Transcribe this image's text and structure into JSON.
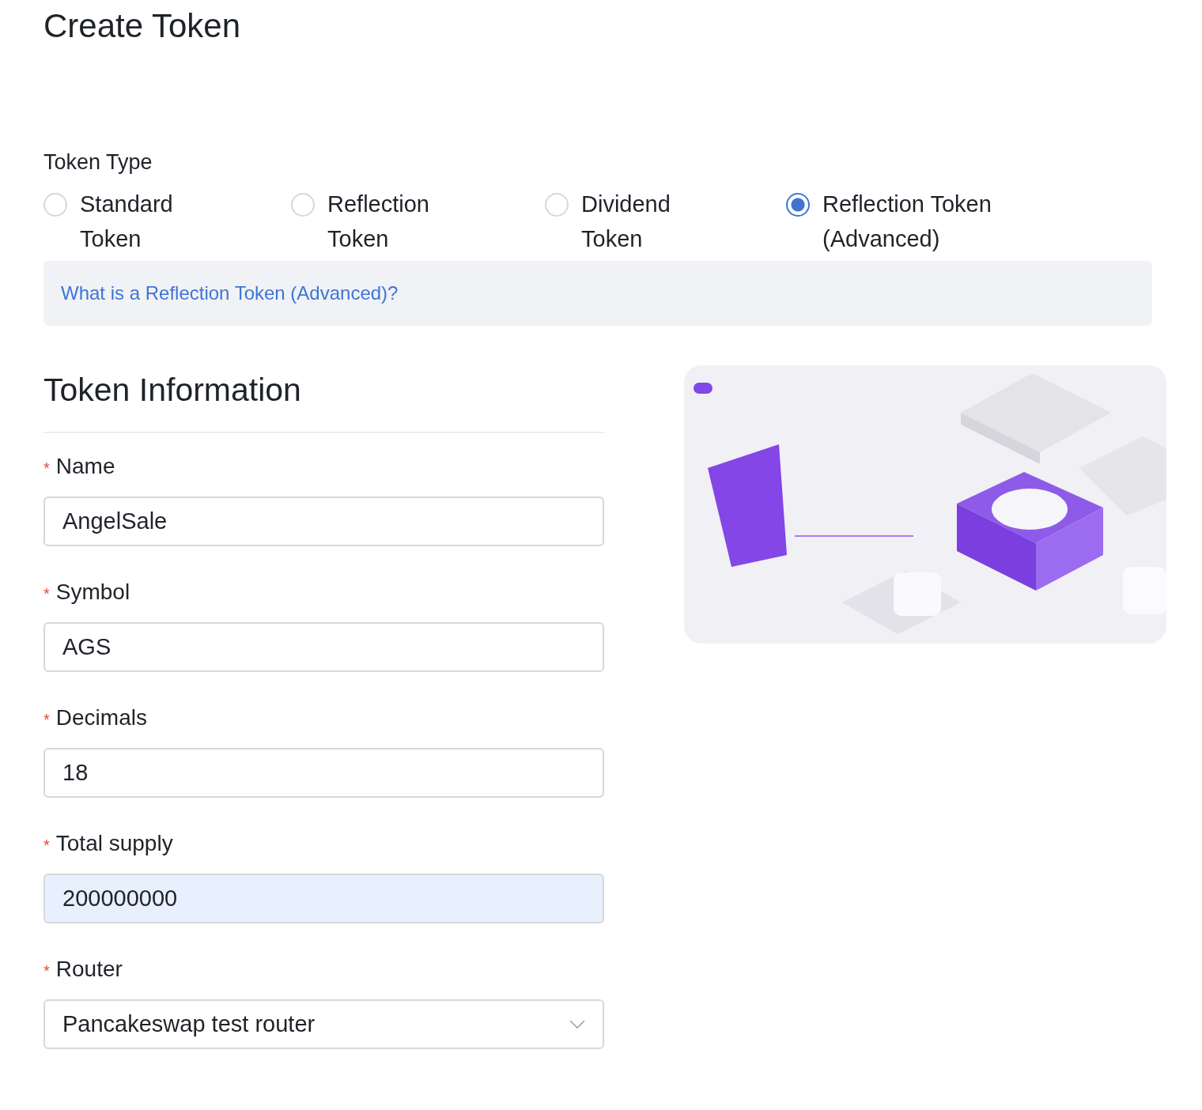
{
  "title": "Create Token",
  "token_type": {
    "label": "Token Type",
    "options": [
      {
        "label": "Standard Token",
        "selected": false
      },
      {
        "label": "Reflection Token",
        "selected": false
      },
      {
        "label": "Dividend Token",
        "selected": false
      },
      {
        "label": "Reflection Token (Advanced)",
        "selected": true
      }
    ]
  },
  "info_link": "What is a Reflection Token (Advanced)?",
  "section_title": "Token Information",
  "fields": [
    {
      "label": "Name",
      "required_mark": "*",
      "kind": "text",
      "value": "AngelSale",
      "autofilled": false
    },
    {
      "label": "Symbol",
      "required_mark": "*",
      "kind": "text",
      "value": "AGS",
      "autofilled": false
    },
    {
      "label": "Decimals",
      "required_mark": "*",
      "kind": "text",
      "value": "18",
      "autofilled": false
    },
    {
      "label": "Total supply",
      "required_mark": "*",
      "kind": "text",
      "value": "200000000",
      "autofilled": true
    },
    {
      "label": "Router",
      "required_mark": "*",
      "kind": "select",
      "value": "Pancakeswap test router"
    }
  ]
}
